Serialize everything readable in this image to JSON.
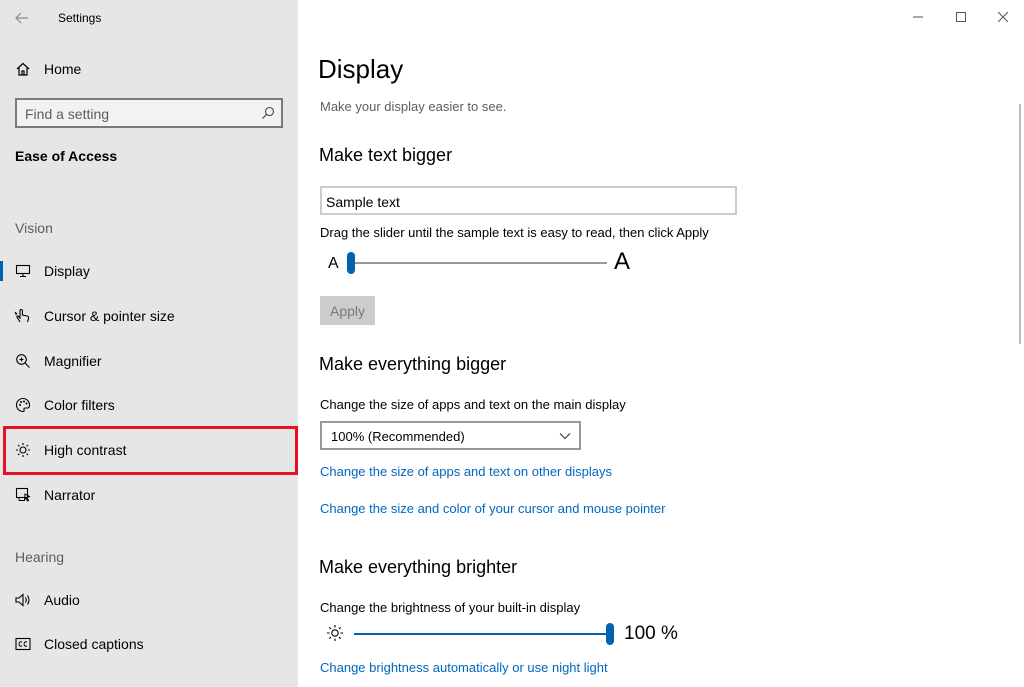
{
  "window": {
    "app_title": "Settings",
    "icons": {
      "back": "back-arrow-icon",
      "minimize": "minimize-icon",
      "maximize": "maximize-icon",
      "close": "close-icon"
    }
  },
  "sidebar": {
    "home_label": "Home",
    "home_icon": "home-icon",
    "search_placeholder": "Find a setting",
    "search_icon": "search-icon",
    "section_title": "Ease of Access",
    "groups": [
      {
        "heading": "Vision",
        "items": [
          {
            "label": "Display",
            "icon": "monitor-icon",
            "selected": true
          },
          {
            "label": "Cursor & pointer size",
            "icon": "pointer-hand-icon"
          },
          {
            "label": "Magnifier",
            "icon": "magnifier-icon"
          },
          {
            "label": "Color filters",
            "icon": "palette-icon"
          },
          {
            "label": "High contrast",
            "icon": "sun-icon",
            "highlighted": true
          },
          {
            "label": "Narrator",
            "icon": "narrator-icon"
          }
        ]
      },
      {
        "heading": "Hearing",
        "items": [
          {
            "label": "Audio",
            "icon": "speaker-icon"
          },
          {
            "label": "Closed captions",
            "icon": "cc-icon"
          }
        ]
      }
    ],
    "accent_color": "#0063b1",
    "highlight_color": "#e81123"
  },
  "main": {
    "title": "Display",
    "subtitle": "Make your display easier to see.",
    "text_bigger": {
      "heading": "Make text bigger",
      "sample_text": "Sample text",
      "instruction": "Drag the slider until the sample text is easy to read, then click Apply",
      "small_label": "A",
      "large_label": "A",
      "slider_value": 0,
      "apply_label": "Apply"
    },
    "everything_bigger": {
      "heading": "Make everything bigger",
      "description": "Change the size of apps and text on the main display",
      "selected_option": "100% (Recommended)",
      "link1": "Change the size of apps and text on other displays",
      "link2": "Change the size and color of your cursor and mouse pointer"
    },
    "everything_brighter": {
      "heading": "Make everything brighter",
      "description": "Change the brightness of your built-in display",
      "brightness_value": "100 %",
      "brightness_level": 1.0,
      "link": "Change brightness automatically or use night light"
    },
    "link_color": "#0067c0"
  }
}
